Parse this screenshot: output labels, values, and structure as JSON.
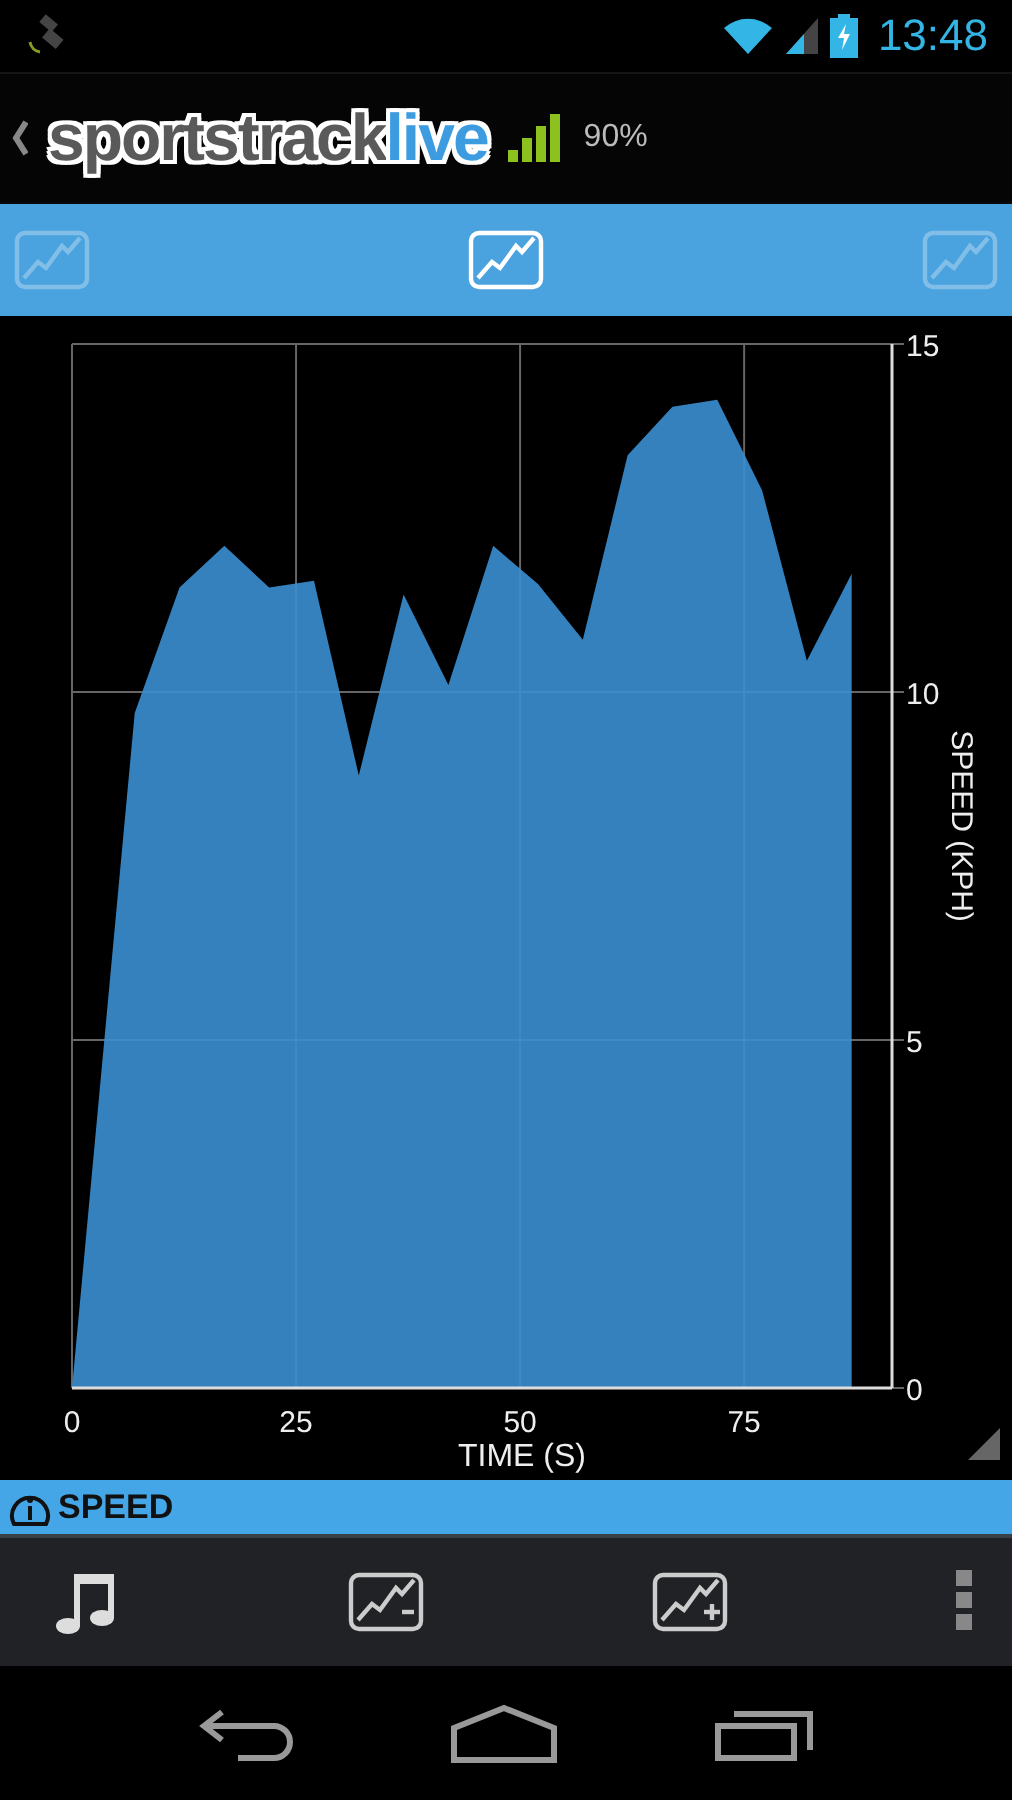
{
  "status_bar": {
    "time": "13:48"
  },
  "app_bar": {
    "logo_main": "sportstrack",
    "logo_accent": "live",
    "signal_text": "90%"
  },
  "tabs": [
    {
      "selected": false
    },
    {
      "selected": true
    },
    {
      "selected": false
    }
  ],
  "chart": {
    "chart_data": {
      "type": "area",
      "xlabel": "TIME (S)",
      "ylabel": "SPEED (KPH)",
      "x": [
        0,
        7,
        12,
        17,
        22,
        27,
        32,
        37,
        42,
        47,
        52,
        57,
        62,
        67,
        72,
        77,
        82,
        87
      ],
      "series": [
        {
          "color": "#3a8fd2",
          "values": [
            0,
            9.7,
            11.5,
            12.1,
            11.5,
            11.6,
            8.8,
            11.4,
            10.1,
            12.1,
            11.55,
            10.75,
            13.4,
            14.1,
            14.2,
            12.9,
            10.45,
            11.7
          ]
        }
      ],
      "xlim": [
        0,
        91.5
      ],
      "ylim": [
        0,
        15
      ],
      "xticks": [
        0,
        25,
        50,
        75
      ],
      "yticks": [
        0,
        5,
        10,
        15
      ],
      "grid": true
    }
  },
  "metric_bar": {
    "label": "SPEED"
  }
}
